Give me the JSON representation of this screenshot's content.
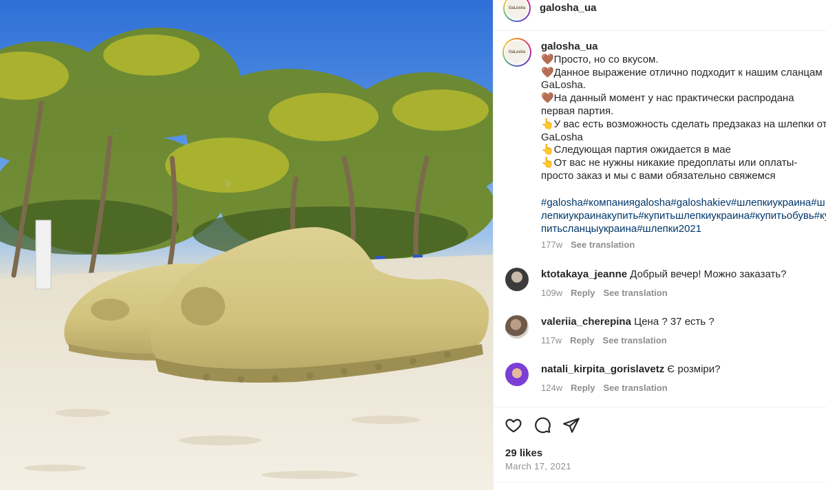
{
  "post": {
    "username": "galosha_ua",
    "avatar_text": "GaLosha",
    "photo_alt": "Beige foam slides on a sandy beach with palm trees",
    "caption_lines": [
      "🤎Просто, но со вкусом.",
      "🤎Данное выражение отлично подходит к нашим сланцам GaLosha.",
      "🤎На данный момент у нас практически распродана первая партия.",
      "👆У вас есть возможность сделать предзаказ на шлепки от GaLosha",
      "👆Следующая партия ожидается в мае",
      "👆От вас не нужны никакие предоплаты или оплаты- просто заказ и мы с вами обязательно свяжемся"
    ],
    "hashtags": "#galosha#компанияgalosha#galoshakiev#шлепкиукраина#шлепкиукраинакупить#купитьшлепкиукраина#купитьобувь#купитьсланцыукраина#шлепки2021",
    "age": "177w",
    "see_translation": "See translation"
  },
  "comments": [
    {
      "user": "ktotakaya_jeanne",
      "text": "Добрый вечер! Можно заказать?",
      "age": "109w",
      "reply": "Reply",
      "see_translation": "See translation"
    },
    {
      "user": "valeriia_cherepina",
      "text": "Цена ? 37 есть ?",
      "age": "117w",
      "reply": "Reply",
      "see_translation": "See translation"
    },
    {
      "user": "natali_kirpita_gorislavetz",
      "text": "Є розміри?",
      "age": "124w",
      "reply": "Reply",
      "see_translation": "See translation"
    }
  ],
  "icons": {
    "like": "heart-icon",
    "comment": "comment-icon",
    "share": "share-icon"
  },
  "footer": {
    "likes": "29 likes",
    "date": "March 17, 2021"
  },
  "colors": {
    "hashtag": "#00376b",
    "muted": "#8e8e8e",
    "text": "#262626"
  }
}
